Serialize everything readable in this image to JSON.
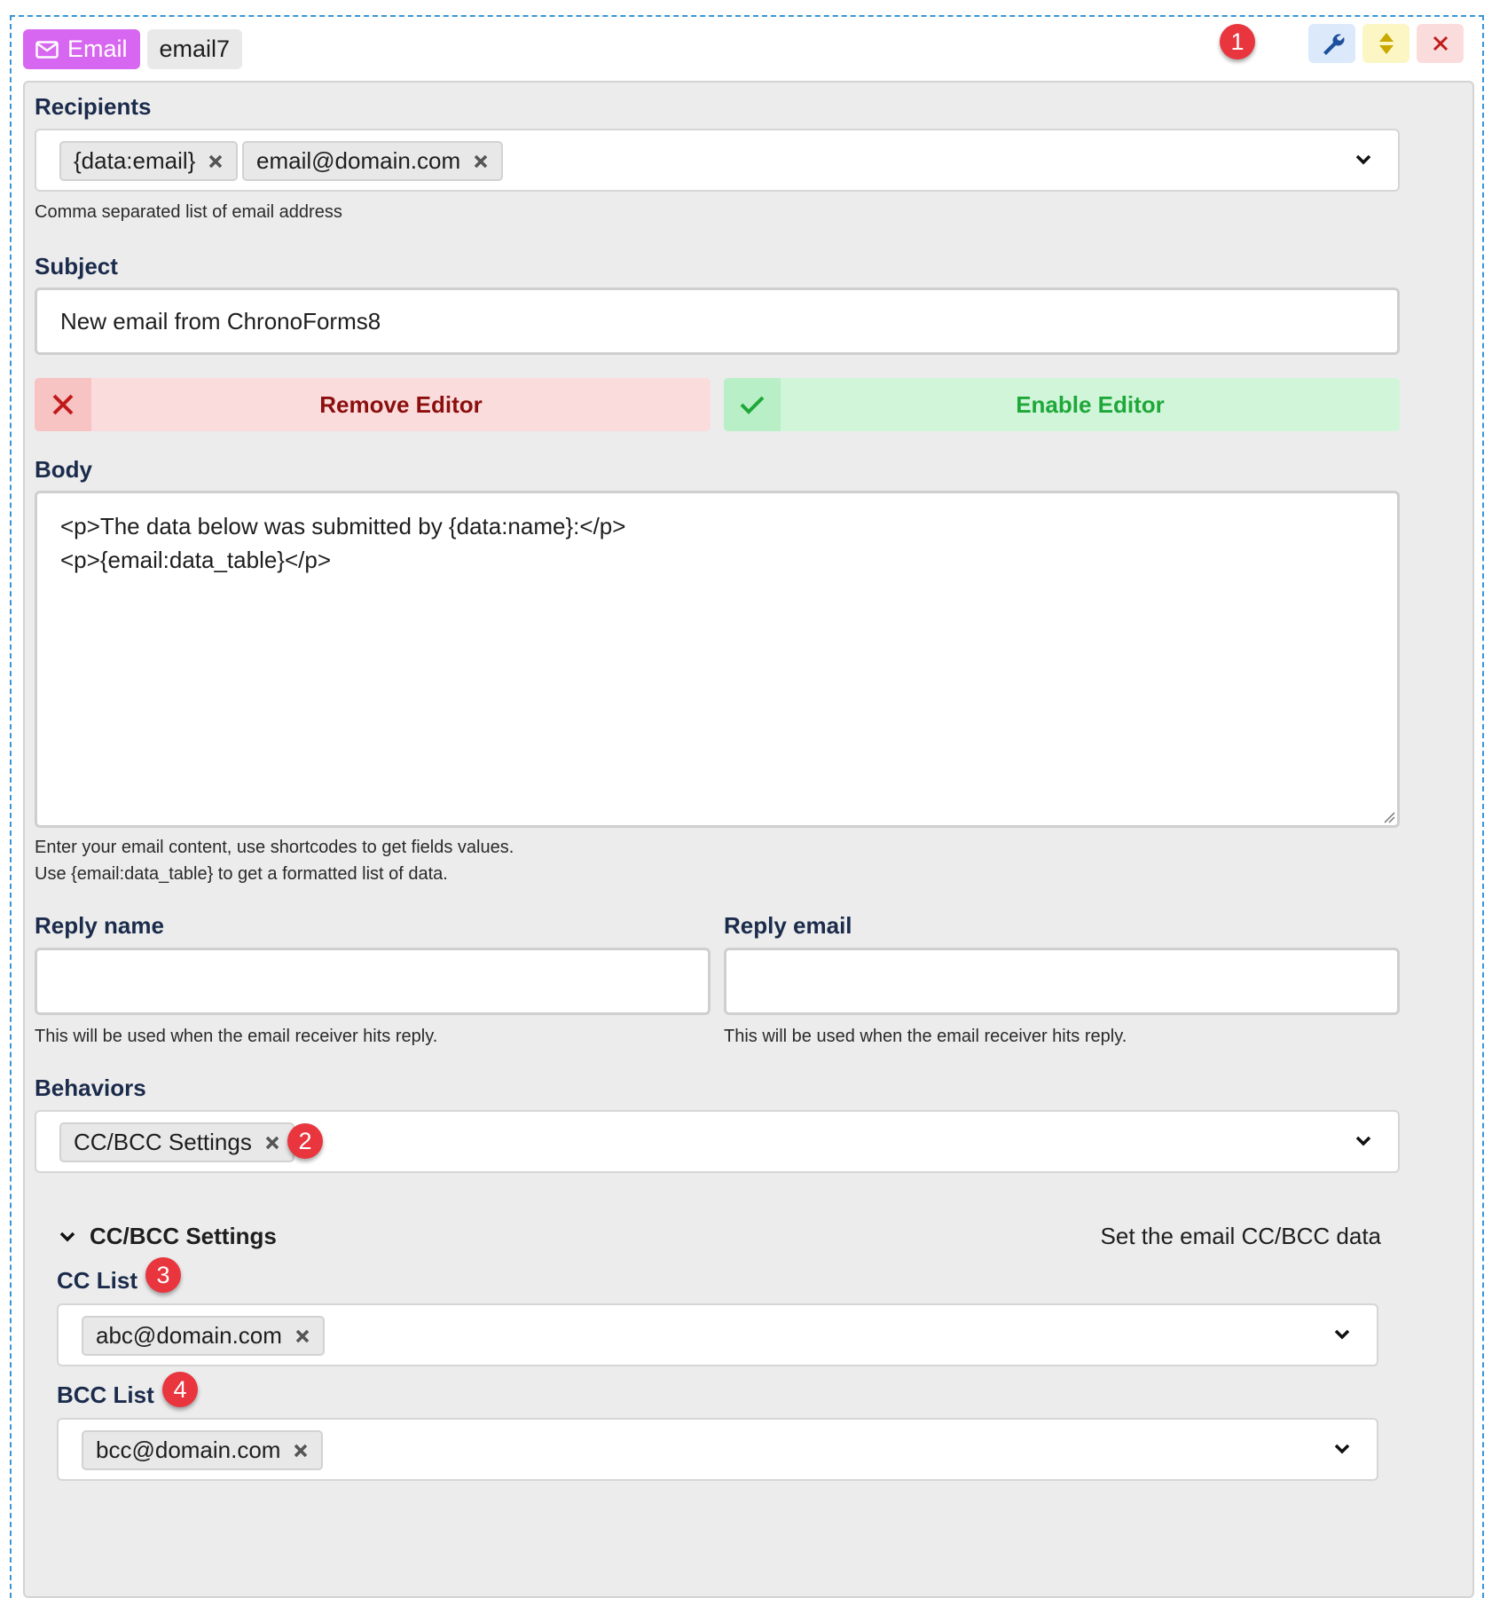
{
  "header": {
    "type_label": "Email",
    "name": "email7"
  },
  "badges": [
    "1",
    "2",
    "3",
    "4"
  ],
  "recipients": {
    "label": "Recipients",
    "chips": [
      "{data:email}",
      "email@domain.com"
    ],
    "hint": "Comma separated list of email address"
  },
  "subject": {
    "label": "Subject",
    "value": "New email from ChronoForms8"
  },
  "editor": {
    "remove_label": "Remove Editor",
    "enable_label": "Enable Editor"
  },
  "body": {
    "label": "Body",
    "lines": [
      "<p>The data below was submitted by {data:name}:</p>",
      "<p>{email:data_table}</p>"
    ],
    "hint_1": "Enter your email content, use shortcodes to get fields values.",
    "hint_2": "Use {email:data_table} to get a formatted list of data."
  },
  "reply_name": {
    "label": "Reply name",
    "value": "",
    "hint": "This will be used when the email receiver hits reply."
  },
  "reply_email": {
    "label": "Reply email",
    "value": "",
    "hint": "This will be used when the email receiver hits reply."
  },
  "behaviors": {
    "label": "Behaviors",
    "chips": [
      "CC/BCC Settings"
    ]
  },
  "ccbcc": {
    "title": "CC/BCC Settings",
    "description": "Set the email CC/BCC data",
    "cc_label": "CC List",
    "cc_chips": [
      "abc@domain.com"
    ],
    "bcc_label": "BCC List",
    "bcc_chips": [
      "bcc@domain.com"
    ]
  },
  "colors": {
    "email_tag": "#d766f0",
    "remove": "#fbdcdc",
    "remove_text": "#8b0f0f",
    "enable": "#d0f5d9",
    "enable_text": "#1fa83a",
    "badge": "#e8353e",
    "dashed_border": "#3a95d6"
  }
}
